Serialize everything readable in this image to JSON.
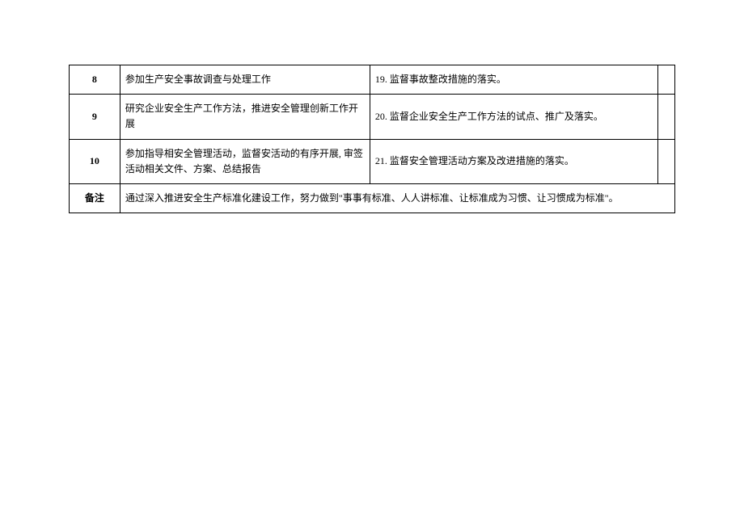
{
  "rows": [
    {
      "num": "8",
      "desc": "参加生产安全事故调查与处理工作",
      "detail": "19. 监督事故整改措施的落实。"
    },
    {
      "num": "9",
      "desc": "研究企业安全生产工作方法，推进安全管理创新工作开展",
      "detail": "20. 监督企业安全生产工作方法的试点、推广及落实。"
    },
    {
      "num": "10",
      "desc": "参加指导相安全管理活动，监督安活动的有序开展, 审签活动相关文件、方案、总结报告",
      "detail": "21. 监督安全管理活动方案及改进措施的落实。"
    }
  ],
  "note": {
    "label": "备注",
    "content": "通过深入推进安全生产标准化建设工作，努力做到\"事事有标准、人人讲标准、让标准成为习惯、让习惯成为标准\"。"
  }
}
